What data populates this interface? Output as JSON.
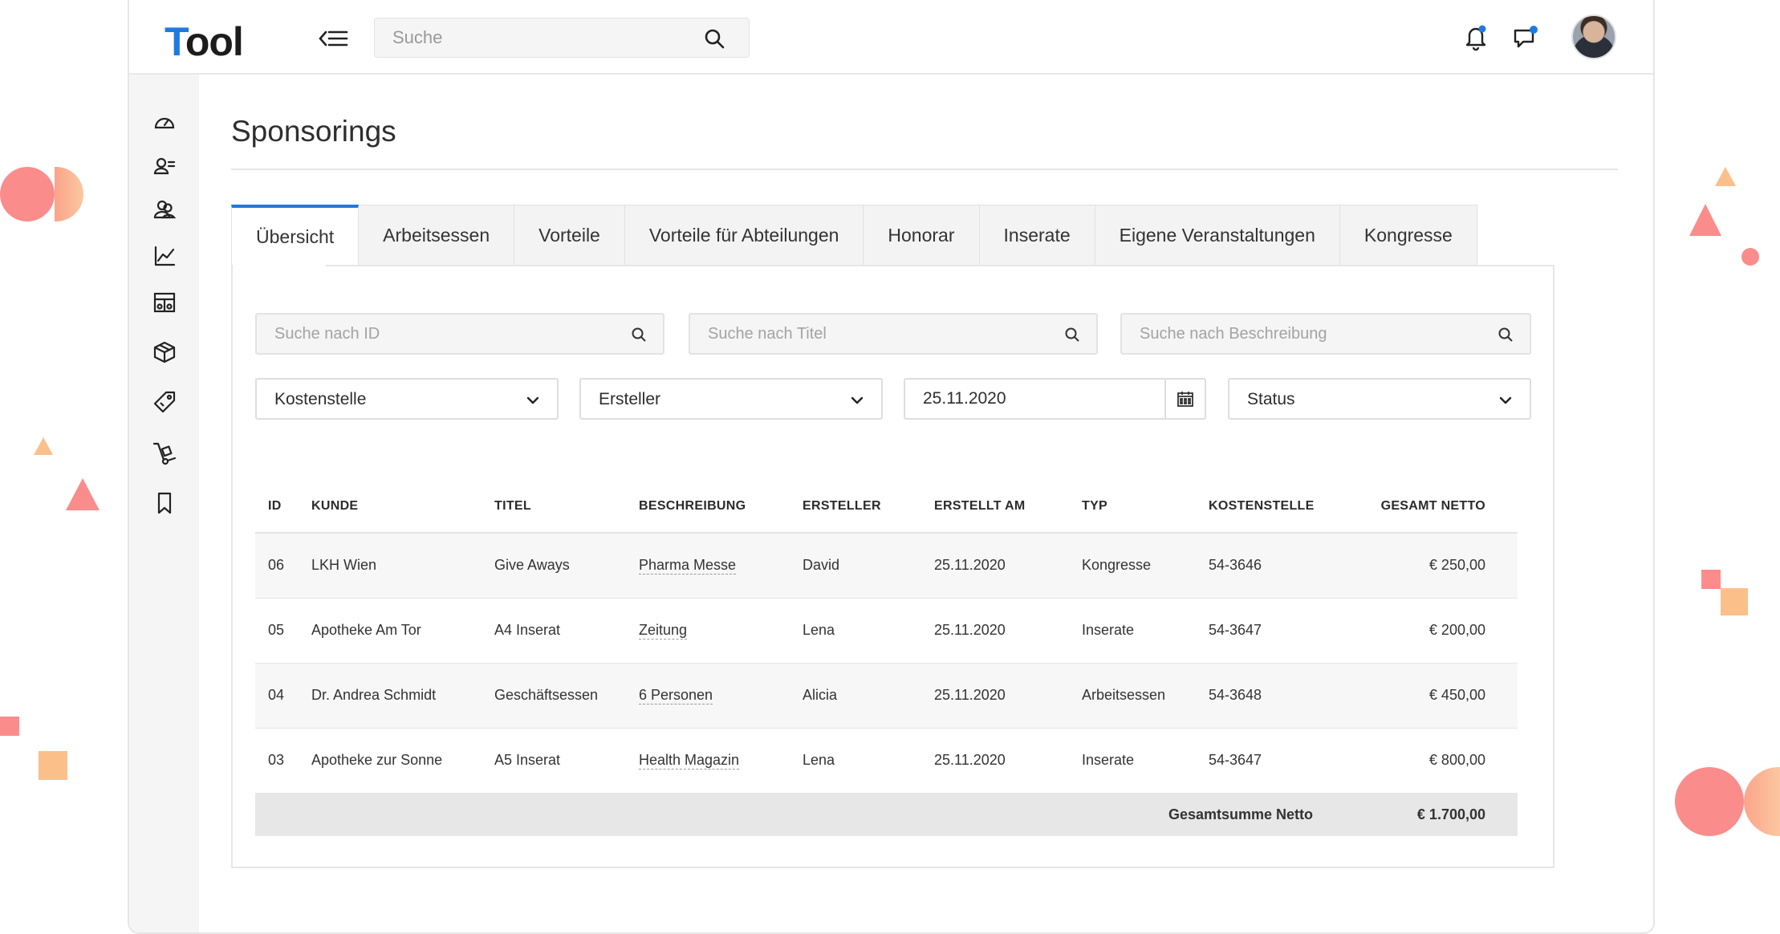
{
  "app": {
    "logo_first": "T",
    "logo_rest": "ool",
    "search_placeholder": "Suche"
  },
  "page": {
    "title": "Sponsorings"
  },
  "tabs": [
    {
      "label": "Übersicht",
      "active": true
    },
    {
      "label": "Arbeitsessen"
    },
    {
      "label": "Vorteile"
    },
    {
      "label": "Vorteile für Abteilungen"
    },
    {
      "label": "Honorar"
    },
    {
      "label": "Inserate"
    },
    {
      "label": "Eigene Veranstaltungen"
    },
    {
      "label": "Kongresse"
    }
  ],
  "filters": {
    "search_id_placeholder": "Suche nach ID",
    "search_title_placeholder": "Suche nach Titel",
    "search_desc_placeholder": "Suche nach Beschreibung",
    "kostenstelle": "Kostenstelle",
    "ersteller": "Ersteller",
    "date": "25.11.2020",
    "status": "Status"
  },
  "table": {
    "columns": [
      "ID",
      "KUNDE",
      "TITEL",
      "BESCHREIBUNG",
      "ERSTELLER",
      "ERSTELLT AM",
      "TYP",
      "KOSTENSTELLE",
      "GESAMT NETTO"
    ],
    "rows": [
      [
        "06",
        "LKH Wien",
        "Give Aways",
        "Pharma Messe",
        "David",
        "25.11.2020",
        "Kongresse",
        "54-3646",
        "€ 250,00"
      ],
      [
        "05",
        "Apotheke Am Tor",
        "A4 Inserat",
        "Zeitung",
        "Lena",
        "25.11.2020",
        "Inserate",
        "54-3647",
        "€ 200,00"
      ],
      [
        "04",
        "Dr. Andrea Schmidt",
        "Geschäftsessen",
        "6 Personen",
        "Alicia",
        "25.11.2020",
        "Arbeitsessen",
        "54-3648",
        "€ 450,00"
      ],
      [
        "03",
        "Apotheke zur Sonne",
        "A5 Inserat",
        "Health Magazin",
        "Lena",
        "25.11.2020",
        "Inserate",
        "54-3647",
        "€ 800,00"
      ]
    ],
    "sum_label": "Gesamtsumme Netto",
    "sum_value": "€ 1.700,00"
  },
  "icons": {
    "sidebar": [
      "dashboard-icon",
      "user-list-icon",
      "users-icon",
      "chart-icon",
      "table-icon",
      "package-icon",
      "tag-icon",
      "hand-truck-icon",
      "bookmark-icon"
    ],
    "topbar": [
      "menu-collapse-icon",
      "search-icon",
      "bell-icon",
      "chat-icon"
    ]
  },
  "colors": {
    "accent": "#1f7ae0",
    "deco_coral": "#fb8c8c",
    "deco_peach": "#fbc08a"
  }
}
